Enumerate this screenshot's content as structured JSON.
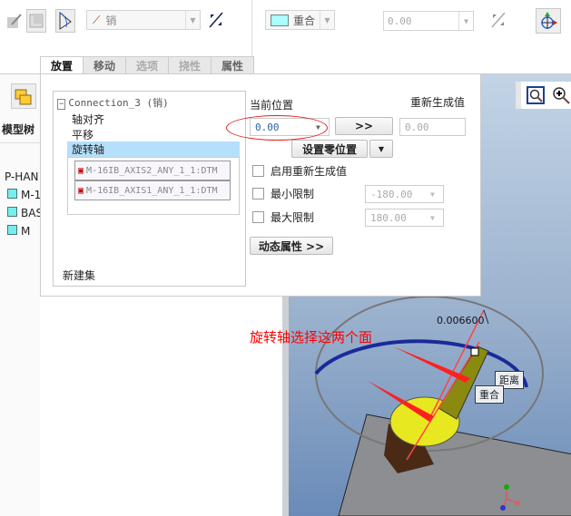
{
  "toolbar": {
    "connection_type": "销",
    "constraint_type": "重合",
    "offset_value": "0.00"
  },
  "tabs": [
    {
      "label": "放置",
      "active": true
    },
    {
      "label": "移动",
      "active": false
    },
    {
      "label": "选项",
      "active": false
    },
    {
      "label": "挠性",
      "active": false
    },
    {
      "label": "属性",
      "active": false
    }
  ],
  "model_tree": {
    "title": "模型树",
    "items": [
      "P-HAN",
      "M-1",
      "BAS",
      "M"
    ]
  },
  "placement": {
    "connection": "Connection_3 (销)",
    "constraints": [
      "轴对齐",
      "平移",
      "旋转轴"
    ],
    "selected_constraint": "旋转轴",
    "references": [
      "M-16IB_AXIS2_ANY_1_1:DTM",
      "M-16IB_AXIS1_ANY_1_1:DTM"
    ],
    "new_set": "新建集"
  },
  "motion": {
    "current_position_label": "当前位置",
    "current_position": "0.00",
    "regen_value_label": "重新生成值",
    "regen_value": "0.00",
    "arrow_button": ">>",
    "set_zero_button": "设置零位置",
    "enable_regen_label": "启用重新生成值",
    "min_limit_label": "最小限制",
    "min_limit": "-180.00",
    "max_limit_label": "最大限制",
    "max_limit": "180.00",
    "dynamic_props_button": "动态属性 >>"
  },
  "viewport": {
    "annotation": "旋转轴选择这两个面",
    "dimension": "0.006600",
    "tag_distance": "距离",
    "tag_coincident": "重合"
  },
  "colors": {
    "accent_red": "#ff0000",
    "selection": "#b5dffb"
  }
}
